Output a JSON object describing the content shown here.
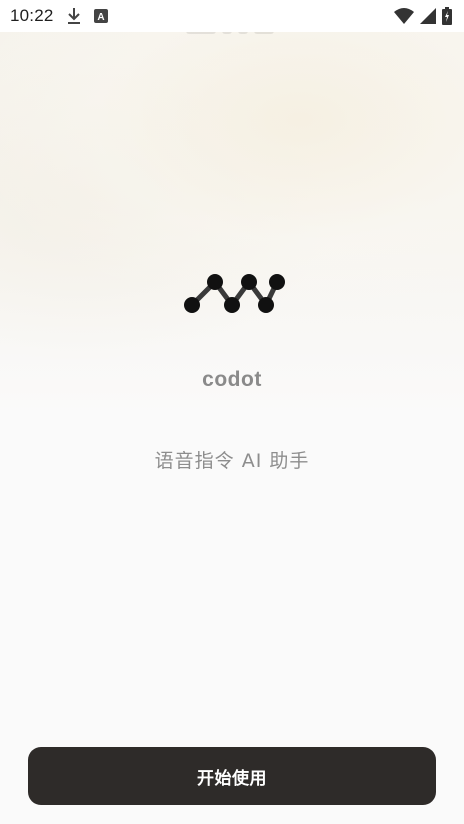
{
  "status_bar": {
    "time": "10:22",
    "icons": [
      "download-icon",
      "a-letter-icon",
      "wifi-icon",
      "signal-icon",
      "battery-icon"
    ],
    "battery_letter": "A"
  },
  "logo": {
    "icon": "wave-dots-logo-icon",
    "color": "#111111"
  },
  "app": {
    "name": "codot",
    "tagline": "语音指令 AI 助手"
  },
  "actions": {
    "start_label": "开始使用"
  },
  "colors": {
    "button_bg": "#2e2b29",
    "button_text": "#ffffff",
    "muted_text": "#8a8a8a"
  }
}
